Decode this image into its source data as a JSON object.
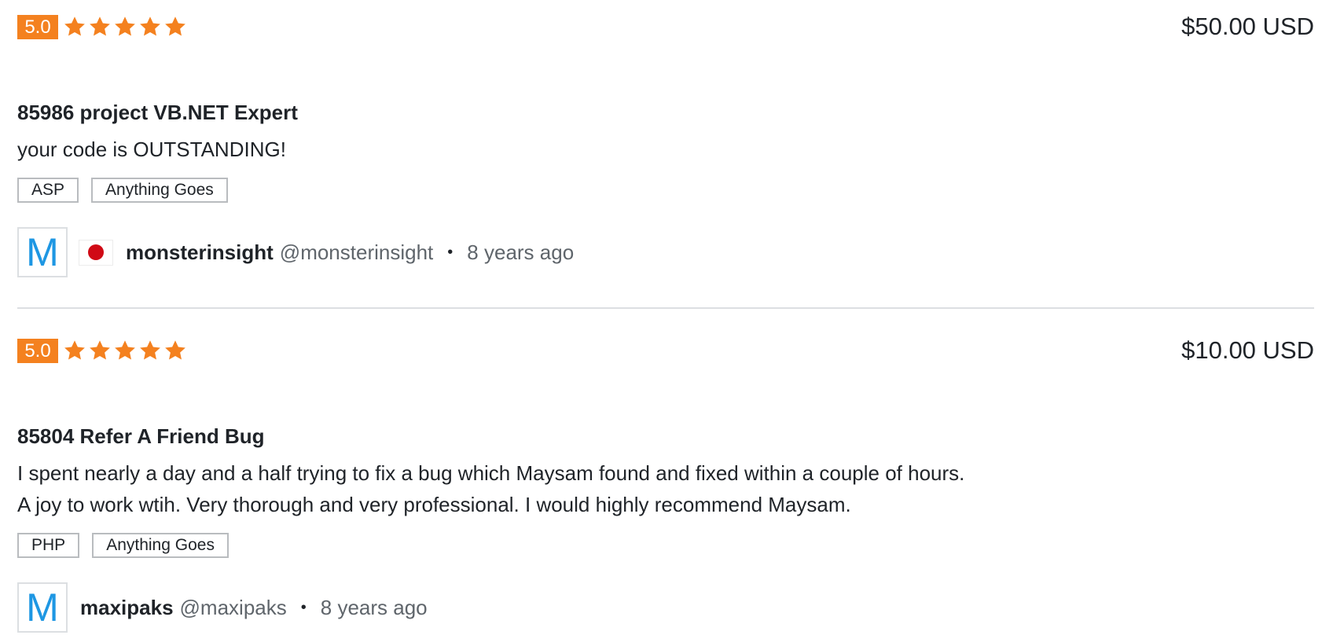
{
  "reviews": [
    {
      "score": "5.0",
      "stars": 5,
      "price": "$50.00 USD",
      "title": "85986 project VB.NET Expert",
      "text": "your code is OUTSTANDING!",
      "tags": [
        "ASP",
        "Anything Goes"
      ],
      "avatar_letter": "M",
      "username": "monsterinsight",
      "handle": "@monsterinsight",
      "separator": "•",
      "time": "8 years ago"
    },
    {
      "score": "5.0",
      "stars": 5,
      "price": "$10.00 USD",
      "title": "85804 Refer A Friend Bug",
      "text": "I spent nearly a day and a half trying to fix a bug which Maysam found and fixed within a couple of hours.\nA joy to work wtih. Very thorough and very professional. I would highly recommend Maysam.",
      "tags": [
        "PHP",
        "Anything Goes"
      ],
      "avatar_letter": "M",
      "username": "maxipaks",
      "handle": "@maxipaks",
      "separator": "•",
      "time": "8 years ago"
    }
  ],
  "colors": {
    "score_bg": "#f4811f",
    "star": "#f4811f",
    "avatar_letter": "#1e97e3",
    "flag_red": "#d00a15"
  },
  "icons": {
    "star": "star-icon",
    "flag": "japan-flag-icon"
  }
}
